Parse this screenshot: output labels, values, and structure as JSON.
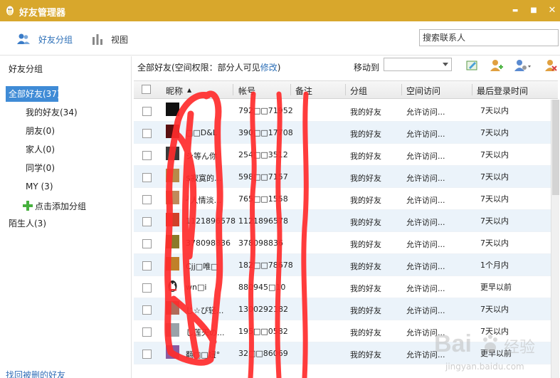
{
  "window": {
    "title": "好友管理器",
    "min_glyph": "▬",
    "max_glyph": "■",
    "close_glyph": "✕"
  },
  "toolbar": {
    "tabs": [
      {
        "label": "好友分组",
        "icon": "users-icon",
        "active": true
      },
      {
        "label": "视图",
        "icon": "bar-chart-icon",
        "active": false
      }
    ],
    "search_placeholder": "搜索联系人"
  },
  "sidebar": {
    "title": "好友分组",
    "groups": [
      {
        "label": "全部好友(37)",
        "selected": true
      },
      {
        "label": "我的好友(34)"
      },
      {
        "label": "朋友(0)"
      },
      {
        "label": "家人(0)"
      },
      {
        "label": "同学(0)"
      },
      {
        "label": "MY (3)"
      }
    ],
    "add_group": "点击添加分组",
    "strangers": "陌生人(3)",
    "recover": "找回被删的好友"
  },
  "main": {
    "info_prefix": "全部好友(空间权限：部分人可见",
    "info_link": "修改",
    "info_suffix": ")",
    "move_to": "移动到",
    "move_select_value": "",
    "columns": [
      "昵称",
      "帐号",
      "备注",
      "分组",
      "空间访问",
      "最后登录时间"
    ],
    "sort_arrow": "▲",
    "rows": [
      {
        "nick": "",
        "account": "792□□71952",
        "group": "我的好友",
        "permission": "允许访问...",
        "last_login": "7天以内",
        "avatar": "#111111"
      },
      {
        "nick": "□□D&L",
        "account": "390□□17708",
        "group": "我的好友",
        "permission": "允许访问...",
        "last_login": "7天以内",
        "avatar": "#5a1010"
      },
      {
        "nick": "シ等ん你",
        "account": "254□□3512",
        "group": "我的好友",
        "permission": "允许访问...",
        "last_login": "7天以内",
        "avatar": "#3a3a3a"
      },
      {
        "nick": "$寂寞的...",
        "account": "598□□7157",
        "group": "我的好友",
        "permission": "允许访问...",
        "last_login": "7天以内",
        "avatar": "#b78a4a"
      },
      {
        "nick": "╯人情淡...",
        "account": "765□□1558",
        "group": "我的好友",
        "permission": "允许访问...",
        "last_login": "7天以内",
        "avatar": "#c08a5a"
      },
      {
        "nick": "1121896578",
        "account": "1121896578",
        "group": "我的好友",
        "permission": "允许访问...",
        "last_login": "7天以内",
        "avatar": "#d0402a"
      },
      {
        "nick": "378098836",
        "account": "378098836",
        "group": "我的好友",
        "permission": "允许访问...",
        "last_login": "7天以内",
        "avatar": "#8a7a2a"
      },
      {
        "nick": "Cjj□唯□",
        "account": "182□□78678",
        "group": "我的好友",
        "permission": "允许访问...",
        "last_login": "1个月内",
        "avatar": "#c0802a"
      },
      {
        "nick": "wn□i",
        "account": "880945□10",
        "group": "我的好友",
        "permission": "允许访问...",
        "last_login": "更早以前",
        "avatar": "qq"
      },
      {
        "nick": "じ☆ぴ轻...",
        "account": "1300292182",
        "group": "我的好友",
        "permission": "允许访问...",
        "last_login": "7天以内",
        "avatar": "#b06a5a"
      },
      {
        "nick": "し莲天の...",
        "account": "195□□0582",
        "group": "我的好友",
        "permission": "允许访问...",
        "last_login": "7天以内",
        "avatar": "#9aa2a8"
      },
      {
        "nick": "翻□□妞°",
        "account": "32□□86069",
        "group": "我的好友",
        "permission": "允许访问...",
        "last_login": "更早以前",
        "avatar": "#8a5aa0"
      }
    ]
  },
  "watermark": {
    "brand": "Bai",
    "brand2": "经验",
    "url": "jingyan.baidu.com"
  },
  "colors": {
    "titlebar": "#d8a72c",
    "selected": "#3f8bd6",
    "link": "#2c6fb7",
    "row_alt": "#ebf3fa",
    "scribble": "#ff2b2b"
  }
}
